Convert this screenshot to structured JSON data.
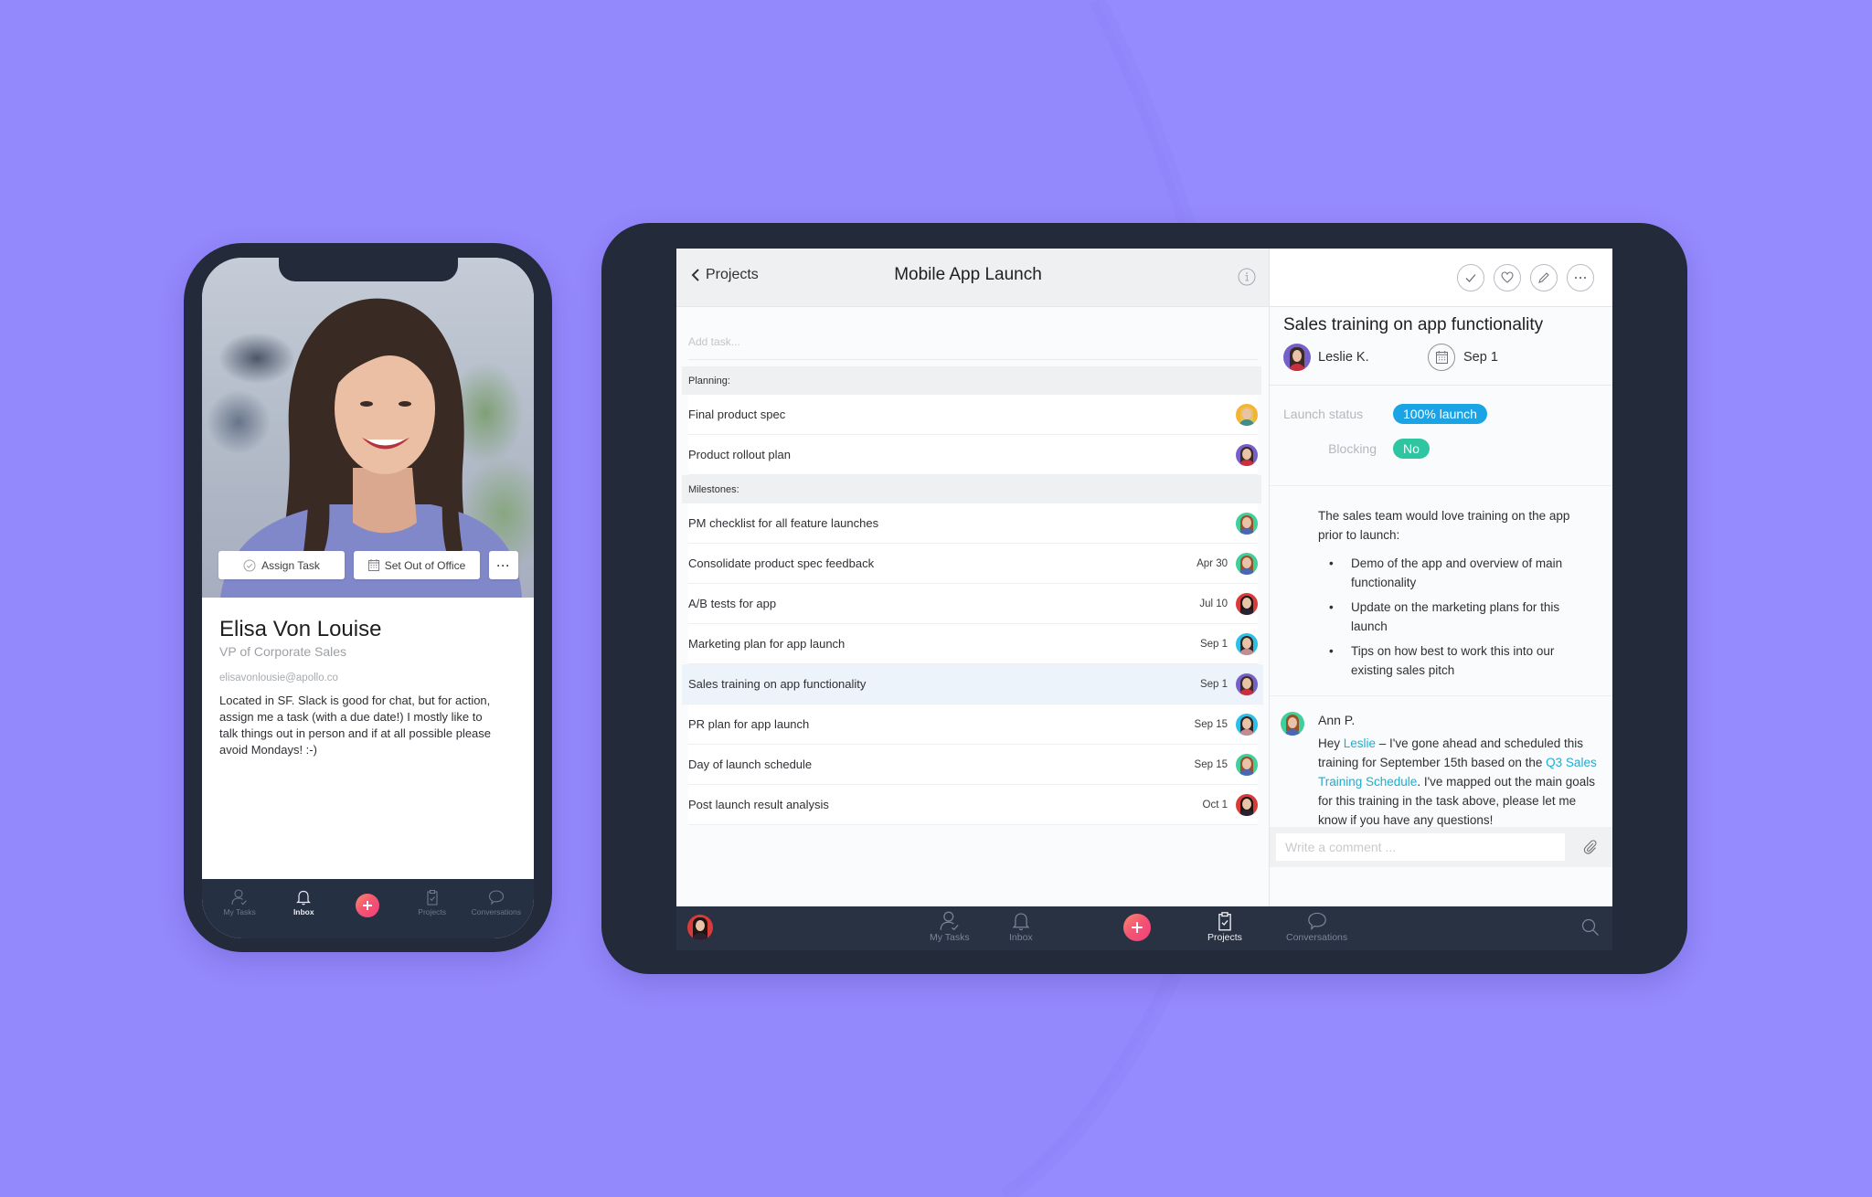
{
  "colors": {
    "background": "#9488fd",
    "device_frame": "#232b3a",
    "accent_add": "#f45673",
    "launch_status_pill": "#1aa4e6",
    "blocking_pill": "#2ec5a0",
    "mention_link": "#1aafd0"
  },
  "phone": {
    "actions": {
      "assign_task": "Assign Task",
      "set_out_of_office": "Set Out of Office",
      "more": "···"
    },
    "profile": {
      "name": "Elisa Von Louise",
      "title": "VP of Corporate Sales",
      "email": "elisavonlousie@apollo.co",
      "bio": "Located in SF. Slack is good for chat, but for action, assign me a task (with a due date!) I mostly like to talk things out in person and if at all possible please avoid Mondays! :-)"
    },
    "nav": [
      {
        "label": "My Tasks",
        "icon": "person-check-icon",
        "active": false
      },
      {
        "label": "Inbox",
        "icon": "bell-icon",
        "active": true
      },
      {
        "label": "Projects",
        "icon": "clipboard-icon",
        "active": false
      },
      {
        "label": "Conversations",
        "icon": "speech-bubble-icon",
        "active": false
      }
    ]
  },
  "tablet": {
    "list": {
      "back_label": "Projects",
      "title": "Mobile App Launch",
      "add_task_placeholder": "Add task...",
      "sections": [
        {
          "name": "Planning:",
          "tasks": [
            {
              "name": "Final product spec",
              "date": "",
              "avatar": "orange"
            },
            {
              "name": "Product rollout plan",
              "date": "",
              "avatar": "purple"
            }
          ]
        },
        {
          "name": "Milestones:",
          "tasks": [
            {
              "name": "PM checklist for all feature launches",
              "date": "",
              "avatar": "green"
            },
            {
              "name": "Consolidate product spec feedback",
              "date": "Apr 30",
              "avatar": "green"
            },
            {
              "name": "A/B tests for app",
              "date": "Jul 10",
              "avatar": "red"
            },
            {
              "name": "Marketing plan for app launch",
              "date": "Sep 1",
              "avatar": "blue"
            },
            {
              "name": "Sales training on app functionality",
              "date": "Sep 1",
              "avatar": "purple",
              "selected": true
            },
            {
              "name": "PR plan for app launch",
              "date": "Sep 15",
              "avatar": "blue"
            },
            {
              "name": "Day of launch schedule",
              "date": "Sep 15",
              "avatar": "green"
            },
            {
              "name": "Post launch result analysis",
              "date": "Oct 1",
              "avatar": "red"
            }
          ]
        }
      ]
    },
    "detail": {
      "title": "Sales training on app functionality",
      "assignee": "Leslie K.",
      "due_date": "Sep 1",
      "fields": [
        {
          "label": "Launch status",
          "value": "100% launch"
        },
        {
          "label": "Blocking",
          "value": "No"
        }
      ],
      "description": {
        "intro": "The sales team would love training on the app prior to launch:",
        "bullets": [
          "Demo of the app and overview of main functionality",
          "Update on the marketing plans for this launch",
          "Tips on how best to work this into our existing sales pitch"
        ]
      },
      "comment": {
        "author": "Ann P.",
        "text_1": "Hey ",
        "mention": "Leslie",
        "text_2": " – I've gone ahead and scheduled this training for September 15th based on the ",
        "link": "Q3 Sales Training Schedule",
        "text_3": ". I've mapped out the main goals for this training in the task above, please let me know if you have any questions!"
      },
      "comment_placeholder": "Write a comment ..."
    },
    "nav": [
      {
        "label": "My Tasks",
        "icon": "person-check-icon",
        "active": false
      },
      {
        "label": "Inbox",
        "icon": "bell-icon",
        "active": false
      },
      {
        "label": "Projects",
        "icon": "clipboard-icon",
        "active": true
      },
      {
        "label": "Conversations",
        "icon": "speech-bubble-icon",
        "active": false
      }
    ]
  }
}
